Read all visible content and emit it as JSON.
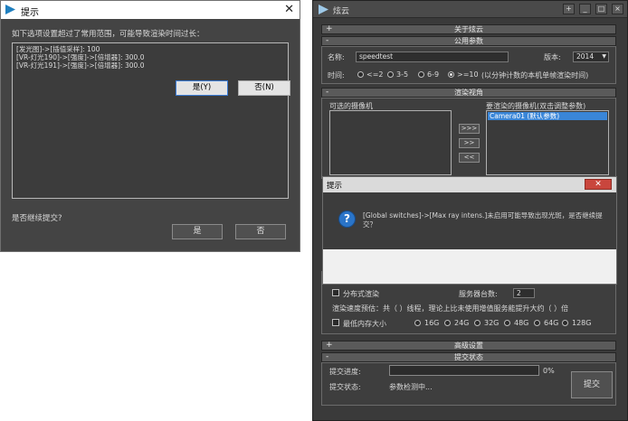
{
  "left_dialog": {
    "title": "提示",
    "close_glyph": "✕",
    "message": "如下选项设置超过了常用范围，可能导致渲染时间过长：",
    "lines": [
      "[发光图]->[插值采样]: 100",
      "[VR-灯光190]->[强度]->[倍增器]: 300.0",
      "[VR-灯光191]->[强度]->[倍增器]: 300.0"
    ],
    "question": "是否继续提交?",
    "yes_label": "是",
    "no_label": "否"
  },
  "right_window": {
    "title": "炫云",
    "about_bar": "关于炫云",
    "common_params": {
      "bar": "公用参数",
      "name_label": "名称:",
      "name_value": "speedtest",
      "version_label": "版本:",
      "version_value": "2014",
      "time_label": "时间:",
      "time_options": [
        "<=2",
        "3-5",
        "6-9",
        ">=10"
      ],
      "time_selected": 3,
      "time_note": "(以分钟计数的本机单帧渲染时间)"
    },
    "render_view": {
      "bar": "渲染视角",
      "available_label": "可选的摄像机",
      "selected_label": "要渲染的摄像机(双击调整参数)",
      "buttons": [
        ">>>",
        ">>",
        "<<"
      ],
      "selected_items": [
        "Camera01 (默认参数)"
      ]
    },
    "lower_area": {
      "distributed_label": "分布式渲染",
      "server_count_label": "服务器台数:",
      "server_count_value": "2",
      "estimate_text": "渲染速度预估：共（ ）线程，理论上比未使用增值服务能提升大约（ ）倍",
      "min_memory_label": "最低内存大小",
      "memory_options": [
        "16G",
        "24G",
        "32G",
        "48G",
        "64G",
        "128G"
      ]
    },
    "advanced_bar": "高级设置",
    "submit_status": {
      "bar": "提交状态",
      "progress_label": "提交进度:",
      "progress_value": 0,
      "progress_text": "0%",
      "status_label": "提交状态:",
      "status_value": "参数检测中...",
      "submit_button": "提交"
    }
  },
  "mid_dialog": {
    "title": "提示",
    "close_glyph": "✕",
    "icon": "question-icon",
    "icon_glyph": "?",
    "message": "[Global switches]->[Max ray intens.]未启用可能导致出现光斑，是否继续提交？",
    "yes_label": "是(Y)",
    "no_label": "否(N)"
  },
  "colors": {
    "dark_bg": "#444444",
    "question_blue": "#2a74c8",
    "close_red": "#c9463d",
    "selection_blue": "#3a86d8"
  }
}
